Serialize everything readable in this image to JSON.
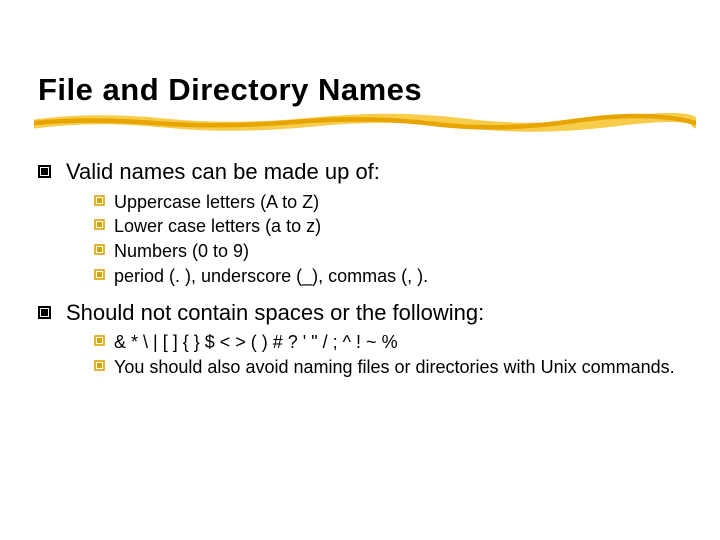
{
  "title": "File and Directory Names",
  "sections": [
    {
      "text": "Valid names can be made up of:",
      "items": [
        "Uppercase letters (A to Z)",
        "Lower case letters (a to z)",
        "Numbers (0 to 9)",
        "period (. ), underscore (_), commas (, )."
      ]
    },
    {
      "text": "Should not contain spaces or the following:",
      "items": [
        "& * \\ | [ ] { } $ < > ( ) # ? ' \" / ; ^ ! ~ %",
        "You should also avoid naming files or directories with Unix commands."
      ]
    }
  ],
  "bullets": {
    "level1": "❚",
    "level2": "❚"
  },
  "colors": {
    "accent": "#f0b000",
    "accent_light": "#f6cc4a"
  }
}
